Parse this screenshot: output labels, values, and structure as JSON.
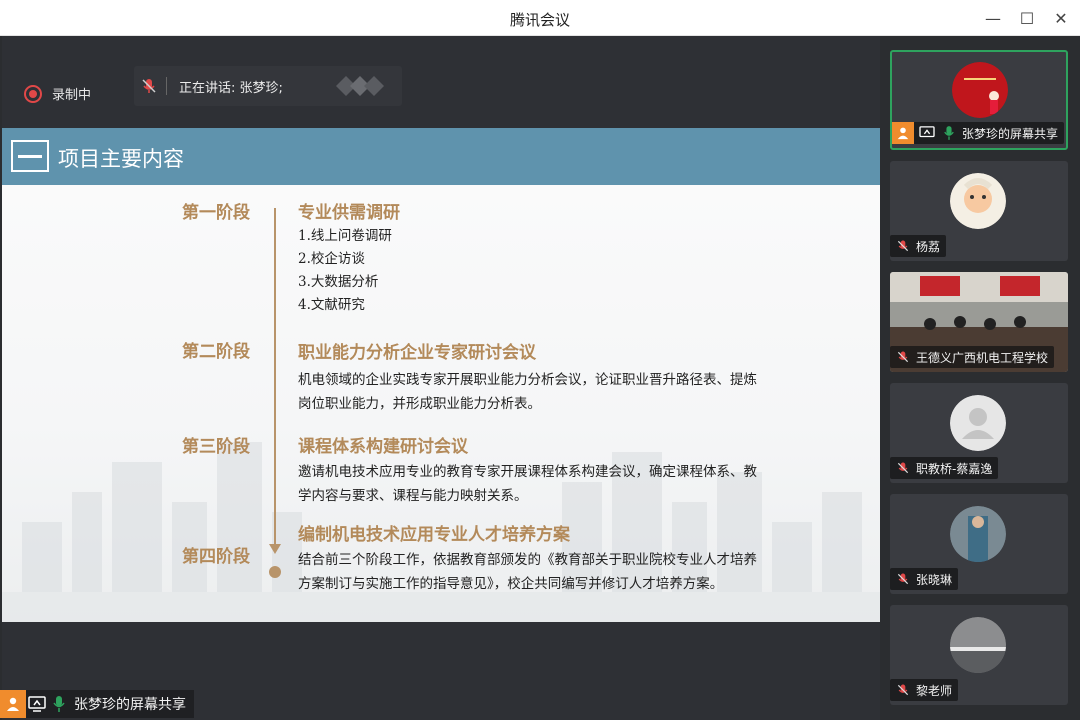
{
  "window": {
    "title": "腾讯会议",
    "minimize_glyph": "—",
    "maximize_glyph": "☐",
    "close_glyph": "✕"
  },
  "status": {
    "recording_label": "录制中",
    "speaking_label": "正在讲话: 张梦珍;"
  },
  "slide": {
    "title": "项目主要内容",
    "stages": [
      {
        "label": "第一阶段",
        "title": "专业供需调研",
        "items": [
          "1.线上问卷调研",
          "2.校企访谈",
          "3.大数据分析",
          "4.文献研究"
        ]
      },
      {
        "label": "第二阶段",
        "title": "职业能力分析企业专家研讨会议",
        "desc": "机电领域的企业实践专家开展职业能力分析会议，论证职业晋升路径表、提炼岗位职业能力，并形成职业能力分析表。"
      },
      {
        "label": "第三阶段",
        "title": "课程体系构建研讨会议",
        "desc": "邀请机电技术应用专业的教育专家开展课程体系构建会议，确定课程体系、教学内容与要求、课程与能力映射关系。"
      },
      {
        "label": "第四阶段",
        "title": "编制机电技术应用专业人才培养方案",
        "desc": "结合前三个阶段工作，依据教育部颁发的《教育部关于职业院校专业人才培养方案制订与实施工作的指导意见》，校企共同编写并修订人才培养方案。"
      }
    ]
  },
  "bottom_share_label": "张梦珍的屏幕共享",
  "participants": [
    {
      "name": "张梦珍的屏幕共享",
      "icon": "person-icon",
      "active": true
    },
    {
      "name": "杨荔",
      "icon": "mic-off-icon"
    },
    {
      "name": "王德义广西机电工程学校",
      "icon": "mic-off-icon"
    },
    {
      "name": "职教桥-蔡嘉逸",
      "icon": "mic-off-icon"
    },
    {
      "name": "张晓琳",
      "icon": "mic-off-icon"
    },
    {
      "name": "黎老师",
      "icon": "mic-off-icon"
    }
  ],
  "colors": {
    "accent_gold": "#b38a5a",
    "header_blue": "#5f93ad",
    "record_red": "#e14848",
    "mic_green": "#2ea35e",
    "share_orange": "#f08c2d"
  }
}
